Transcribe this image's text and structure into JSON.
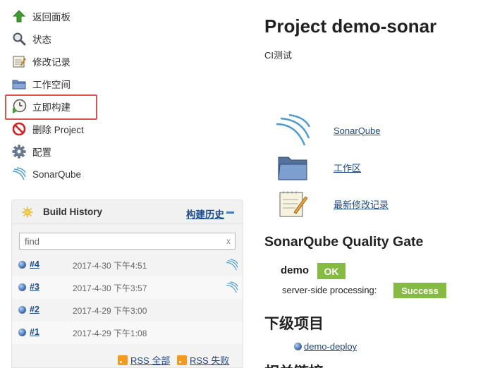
{
  "sidebar": {
    "items": [
      {
        "label": "返回面板",
        "icon": "arrow-up-icon"
      },
      {
        "label": "状态",
        "icon": "magnifier-icon"
      },
      {
        "label": "修改记录",
        "icon": "notepad-icon"
      },
      {
        "label": "工作空间",
        "icon": "folder-icon"
      },
      {
        "label": "立即构建",
        "icon": "clock-build-icon"
      },
      {
        "label": "删除 Project",
        "icon": "no-entry-icon"
      },
      {
        "label": "配置",
        "icon": "gear-icon"
      },
      {
        "label": "SonarQube",
        "icon": "sonarqube-icon"
      }
    ]
  },
  "build_history": {
    "title": "Build History",
    "trend_link": "构建历史",
    "filter_value": "find",
    "filter_clear": "x",
    "builds": [
      {
        "number": "#4",
        "date": "2017-4-30 下午4:51",
        "sonar": true
      },
      {
        "number": "#3",
        "date": "2017-4-30 下午3:57",
        "sonar": true
      },
      {
        "number": "#2",
        "date": "2017-4-29 下午3:00",
        "sonar": false
      },
      {
        "number": "#1",
        "date": "2017-4-29 下午1:08",
        "sonar": false
      }
    ],
    "rss_all": "RSS 全部",
    "rss_failed": "RSS 失败"
  },
  "main": {
    "title": "Project demo-sonar",
    "description": "CI测试",
    "links": [
      {
        "label": "SonarQube",
        "icon": "sonarqube-icon"
      },
      {
        "label": "工作区",
        "icon": "folder-icon"
      },
      {
        "label": "最新修改记录",
        "icon": "notepad-icon"
      }
    ],
    "quality_gate": {
      "title": "SonarQube Quality Gate",
      "project": "demo",
      "status": "OK",
      "ssp_label": "server-side processing:",
      "ssp_status": "Success"
    },
    "downstream_title": "下级项目",
    "downstream_item": "demo-deploy",
    "related_title": "相关链接"
  },
  "colors": {
    "link": "#204a87",
    "ok": "#85bb43",
    "highlight": "#d9534f"
  }
}
